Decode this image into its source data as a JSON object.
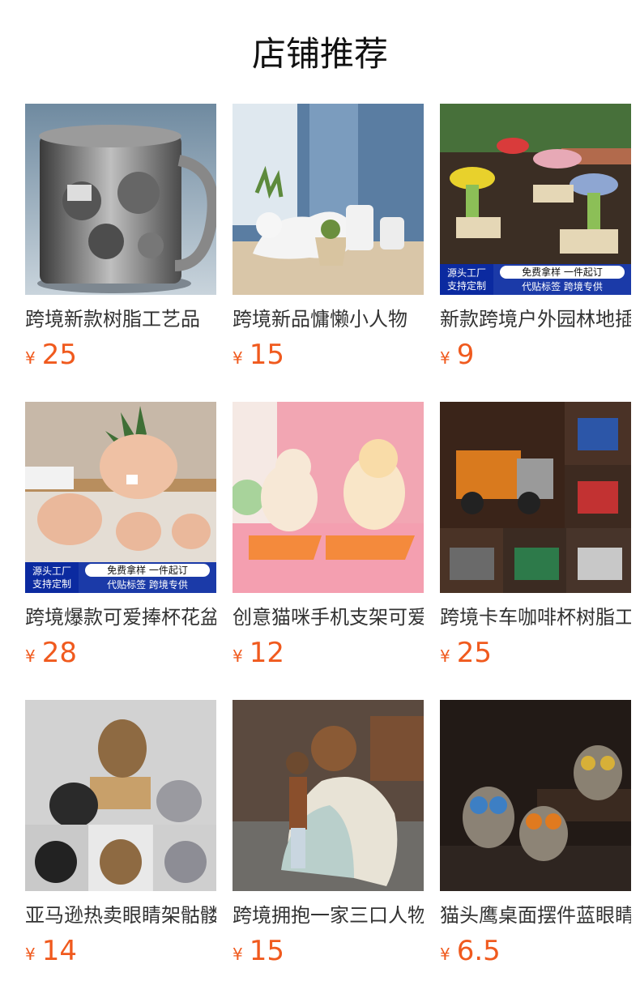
{
  "page": {
    "title": "店铺推荐"
  },
  "currency": "¥",
  "banner": {
    "left_line1": "源头工厂",
    "left_line2": "支持定制",
    "pill": "免费拿样  一件起订",
    "sub": "代贴标签  跨境专供"
  },
  "products": [
    {
      "title": "跨境新款树脂工艺品",
      "price": "25",
      "image": "engine-mug"
    },
    {
      "title": "跨境新品慵懒小人物",
      "price": "15",
      "image": "lazy-figure-planter"
    },
    {
      "title": "新款跨境户外园林地插",
      "price": "9",
      "image": "garden-stakes"
    },
    {
      "title": "跨境爆款可爱捧杯花盆",
      "price": "28",
      "image": "cup-planter"
    },
    {
      "title": "创意猫咪手机支架可爱",
      "price": "12",
      "image": "cat-phone-stand"
    },
    {
      "title": "跨境卡车咖啡杯树脂工",
      "price": "25",
      "image": "truck-mug"
    },
    {
      "title": "亚马逊热卖眼睛架骷髅",
      "price": "14",
      "image": "skull-glasses-holder"
    },
    {
      "title": "跨境拥抱一家三口人物",
      "price": "15",
      "image": "family-figurine"
    },
    {
      "title": "猫头鹰桌面摆件蓝眼睛",
      "price": "6.5",
      "image": "owl-ornament"
    }
  ],
  "colors": {
    "price": "#f05a1e",
    "banner": "#1b3aa8"
  }
}
